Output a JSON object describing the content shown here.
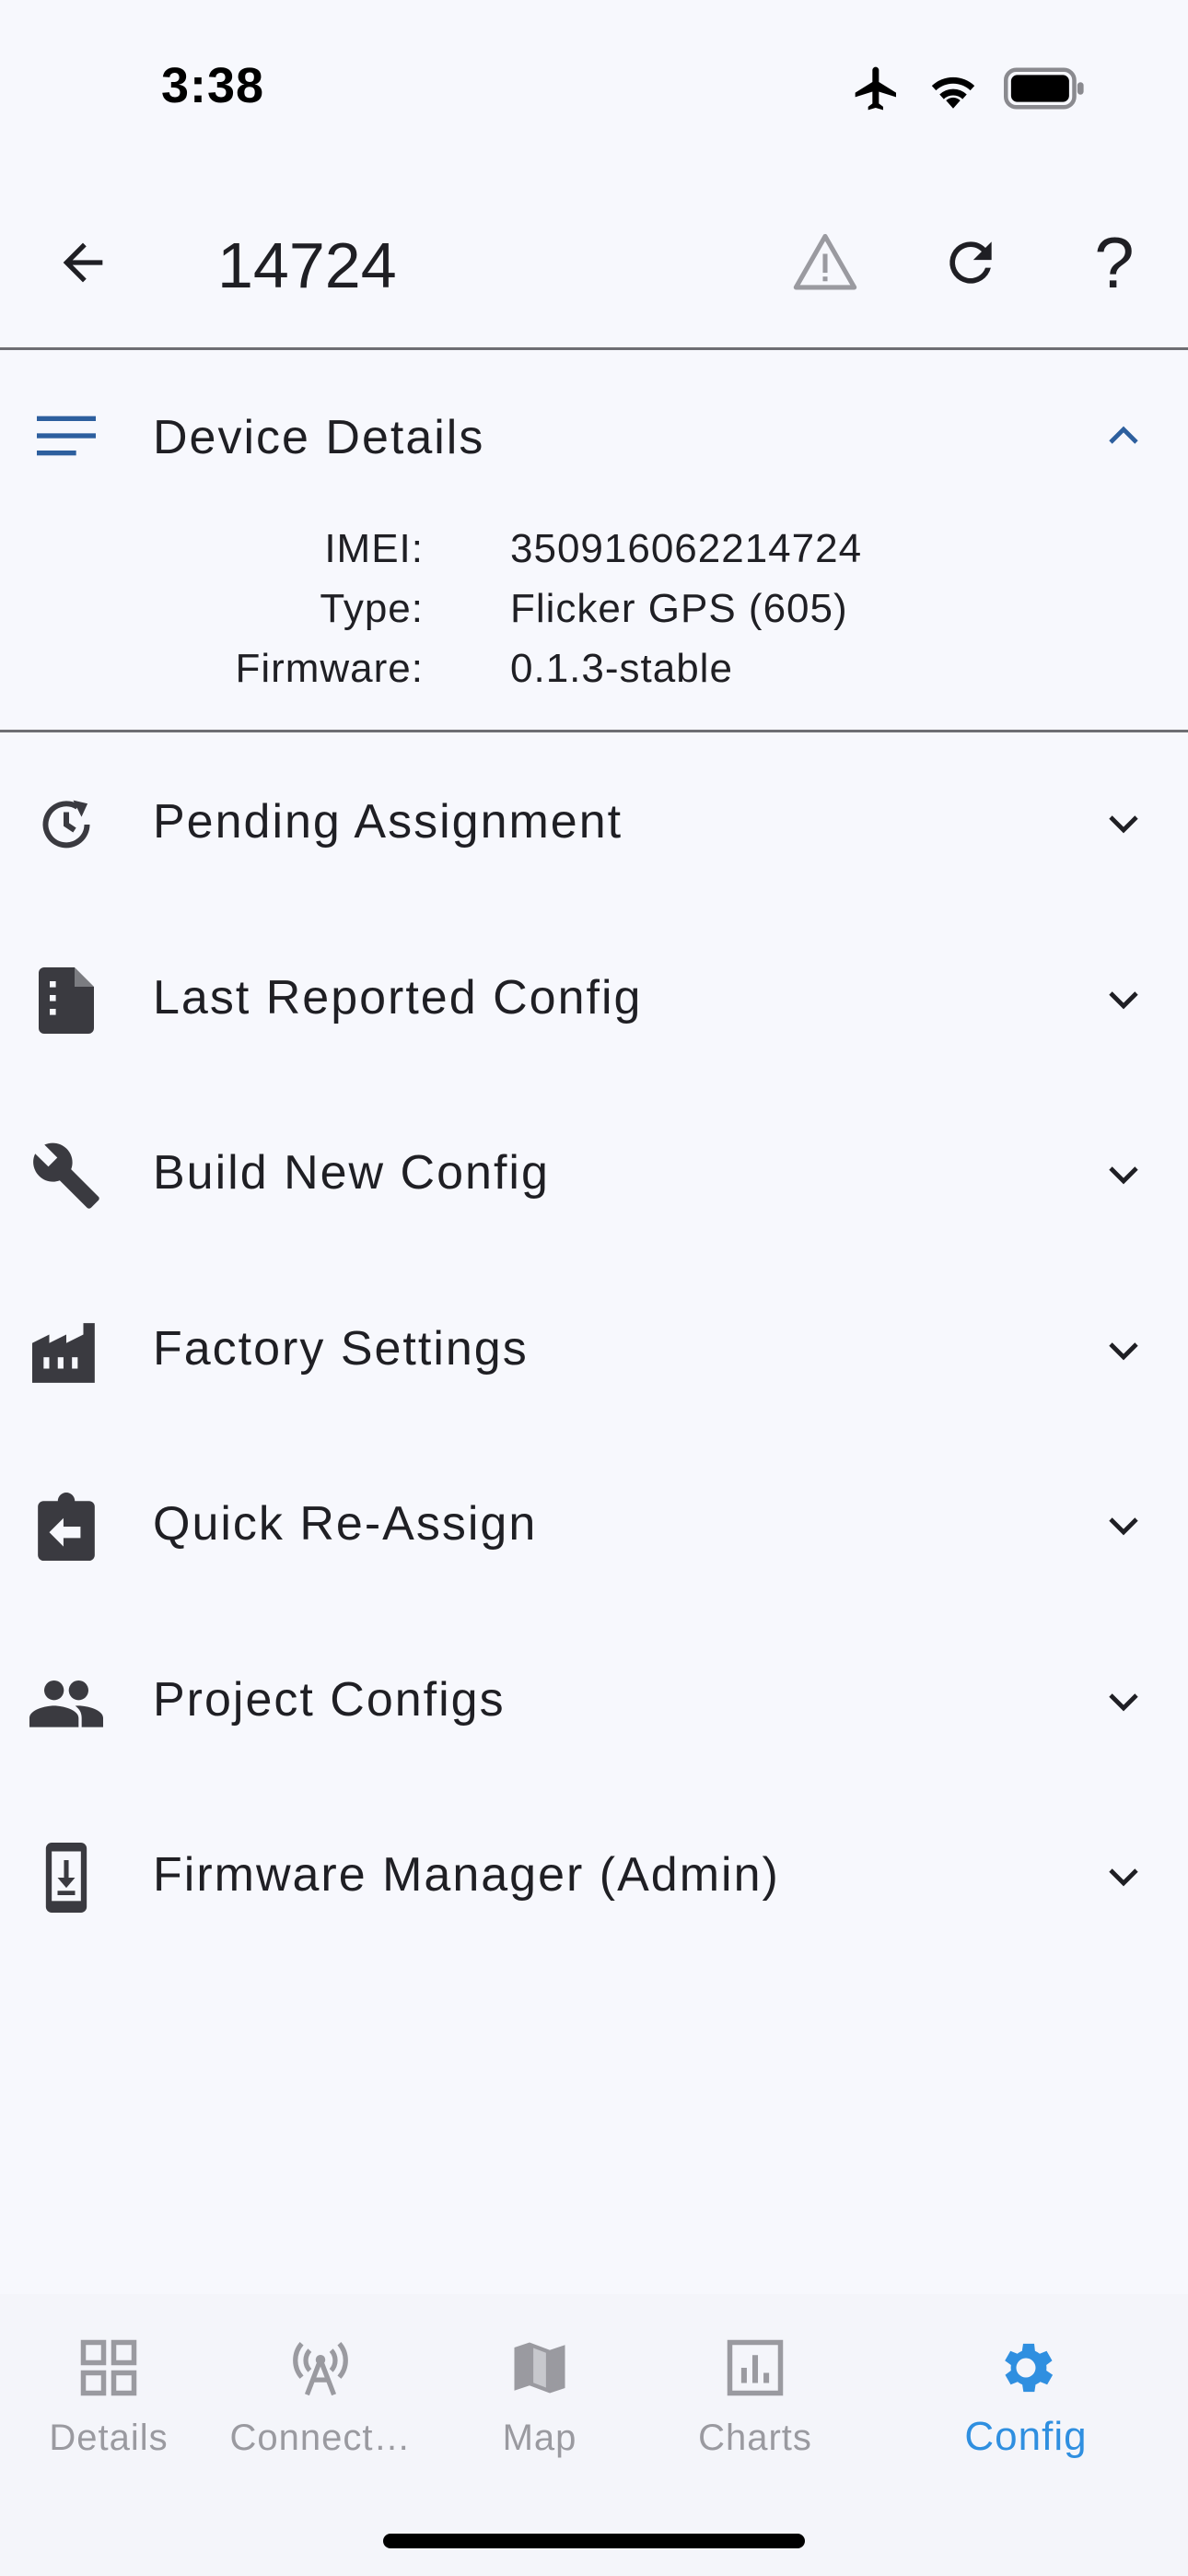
{
  "status_bar": {
    "time": "3:38",
    "icons": [
      "airplane-icon",
      "wifi-icon",
      "battery-icon"
    ]
  },
  "app_bar": {
    "title": "14724",
    "back_icon": "arrow-left-icon",
    "actions": [
      "warning-icon",
      "refresh-icon",
      "help-icon"
    ],
    "help_glyph": "?"
  },
  "device_details": {
    "title": "Device Details",
    "expanded": true,
    "rows": [
      {
        "key": "IMEI:",
        "value": "350916062214724"
      },
      {
        "key": "Type:",
        "value": "Flicker GPS (605)"
      },
      {
        "key": "Firmware:",
        "value": "0.1.3-stable"
      }
    ]
  },
  "sections": [
    {
      "label": "Pending Assignment",
      "icon": "history-icon"
    },
    {
      "label": "Last Reported Config",
      "icon": "document-icon"
    },
    {
      "label": "Build New Config",
      "icon": "wrench-icon"
    },
    {
      "label": "Factory Settings",
      "icon": "factory-icon"
    },
    {
      "label": "Quick Re-Assign",
      "icon": "clipboard-arrow-icon"
    },
    {
      "label": "Project Configs",
      "icon": "people-icon"
    },
    {
      "label": "Firmware Manager (Admin)",
      "icon": "phone-download-icon"
    }
  ],
  "bottom_nav": {
    "tabs": [
      {
        "label": "Details",
        "icon": "grid-icon",
        "active": false
      },
      {
        "label": "Connect…",
        "icon": "antenna-icon",
        "active": false
      },
      {
        "label": "Map",
        "icon": "map-icon",
        "active": false
      },
      {
        "label": "Charts",
        "icon": "chart-icon",
        "active": false
      },
      {
        "label": "Config",
        "icon": "gear-icon",
        "active": true
      }
    ]
  },
  "colors": {
    "background": "#f7f8fd",
    "accent": "#2f8fe0",
    "header_icon": "#2d5f9e",
    "inactive_nav": "#9a9aa0",
    "text": "#1f1f24",
    "divider": "#6e6e73"
  }
}
